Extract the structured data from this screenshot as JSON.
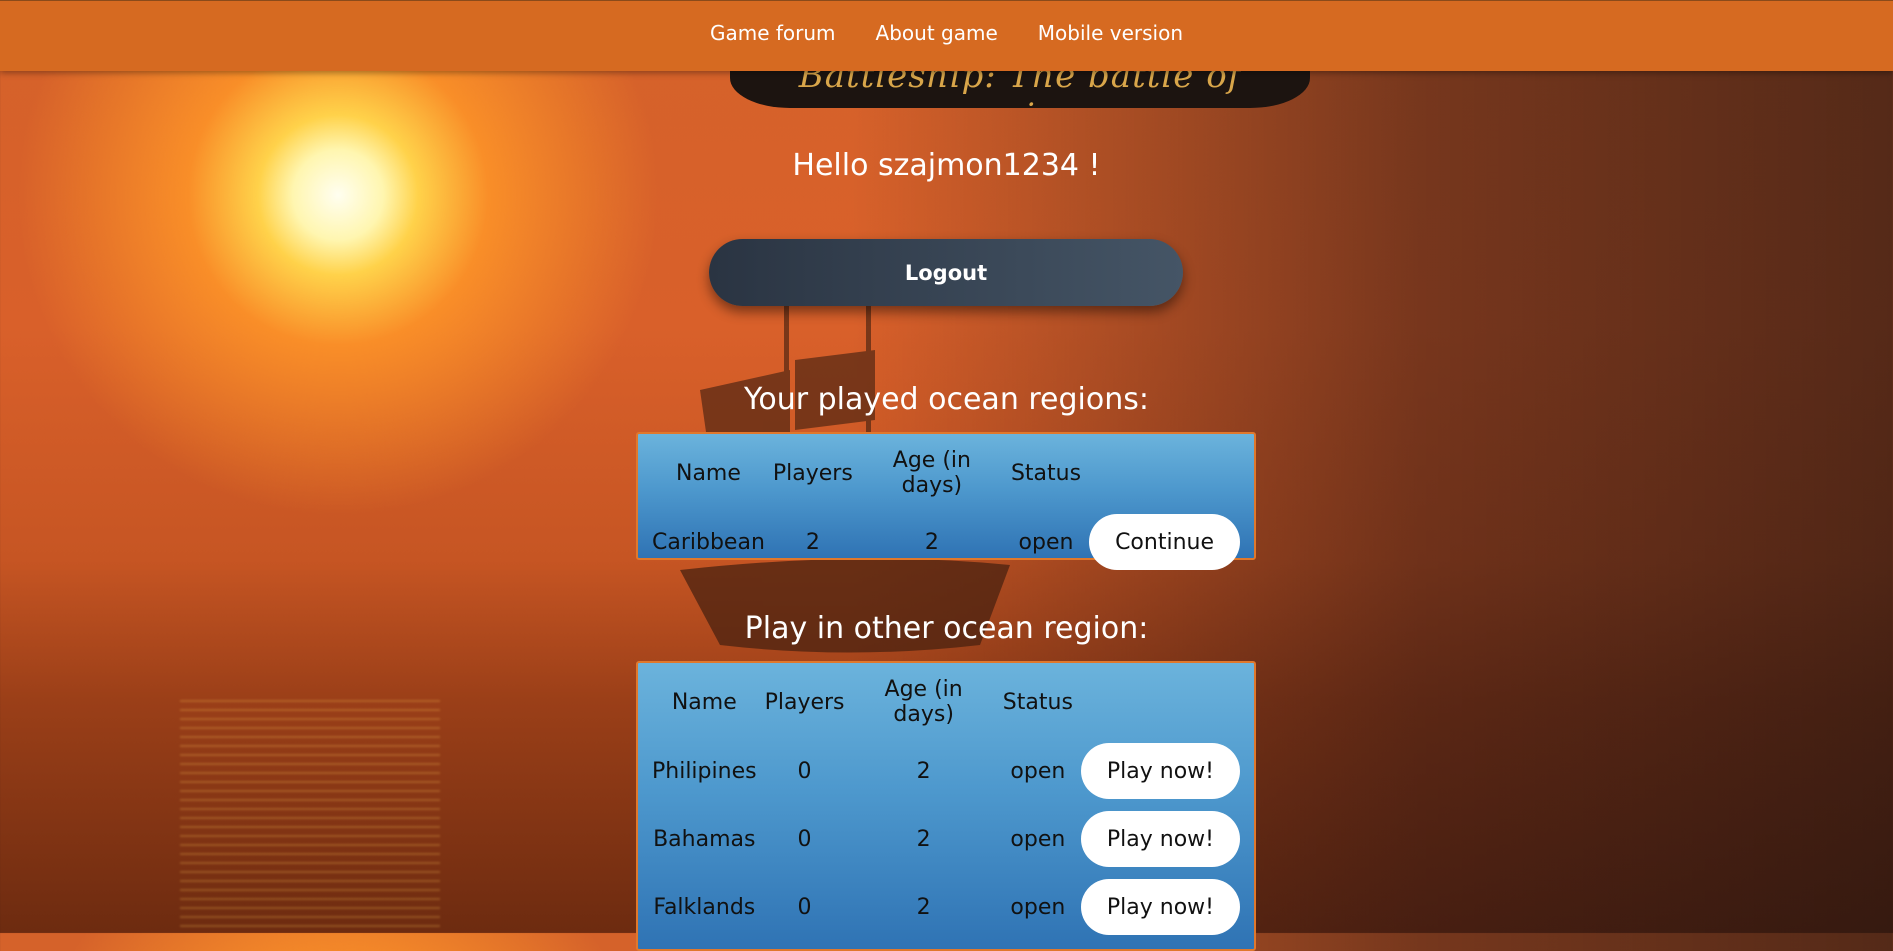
{
  "nav": {
    "items": [
      {
        "label": "Game forum"
      },
      {
        "label": "About game"
      },
      {
        "label": "Mobile version"
      }
    ]
  },
  "logo": {
    "text": "Battleship: The battle of survivor"
  },
  "greeting": "Hello szajmon1234 !",
  "logout_label": "Logout",
  "played": {
    "title": "Your played ocean regions:",
    "headers": [
      "Name",
      "Players",
      "Age (in days)",
      "Status"
    ],
    "rows": [
      {
        "name": "Caribbean",
        "players": "2",
        "age": "2",
        "status": "open",
        "action": "Continue"
      }
    ]
  },
  "other": {
    "title": "Play in other ocean region:",
    "headers": [
      "Name",
      "Players",
      "Age (in days)",
      "Status"
    ],
    "rows": [
      {
        "name": "Philipines",
        "players": "0",
        "age": "2",
        "status": "open",
        "action": "Play now!"
      },
      {
        "name": "Bahamas",
        "players": "0",
        "age": "2",
        "status": "open",
        "action": "Play now!"
      },
      {
        "name": "Falklands",
        "players": "0",
        "age": "2",
        "status": "open",
        "action": "Play now!"
      }
    ]
  },
  "colors": {
    "navbar": "#d66a21",
    "logout_button": "#2a3442",
    "panel_blue": "#4d98cd",
    "panel_border": "#e0782c"
  }
}
